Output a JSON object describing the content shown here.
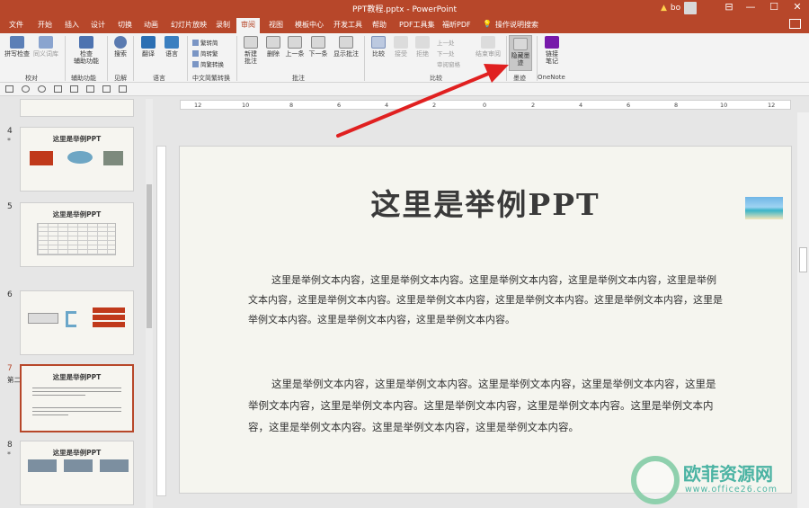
{
  "titlebar": {
    "title": "PPT教程.pptx  -  PowerPoint",
    "user": "bo",
    "warn": "▲",
    "minimize": "—",
    "maximize": "☐",
    "close": "✕",
    "ribbon_toggle": "⊟"
  },
  "tabs": [
    "文件",
    "开始",
    "插入",
    "设计",
    "切换",
    "动画",
    "幻灯片放映",
    "录制",
    "审阅",
    "视图",
    "模板中心",
    "开发工具",
    "帮助",
    "PDF工具集",
    "福昕PDF"
  ],
  "search_label": "操作说明搜索",
  "ribbon": {
    "proof": {
      "spell": "拼写检查",
      "thesaurus": "同义词库",
      "group": "校对"
    },
    "access": {
      "check": "检查",
      "check2": "辅助功能",
      "group": "辅助功能"
    },
    "insights": {
      "search": "搜索",
      "group": "见解"
    },
    "language": {
      "translate": "翻译",
      "lang": "语言",
      "group": "语言"
    },
    "chinese": {
      "t2s": "繁转简",
      "s2t": "简转繁",
      "convert": "简繁转换",
      "group": "中文简繁转换"
    },
    "comments": {
      "new1": "新建",
      "new2": "批注",
      "delete": "删除",
      "prev": "上一条",
      "next": "下一条",
      "show": "显示批注",
      "group": "批注"
    },
    "compare": {
      "compare": "比较",
      "accept": "接受",
      "reject": "拒绝",
      "prev": "上一处",
      "next": "下一处",
      "pane": "审阅窗格",
      "end": "结束审阅",
      "group": "比较"
    },
    "ink": {
      "hide1": "隐藏墨",
      "hide2": "迹",
      "group": "墨迹"
    },
    "onenote": {
      "link1": "链接",
      "link2": "笔记",
      "group": "OneNote"
    }
  },
  "ruler_ticks": [
    "12",
    "10",
    "8",
    "6",
    "4",
    "2",
    "0",
    "2",
    "4",
    "6",
    "8",
    "10",
    "12"
  ],
  "slides_panel": {
    "section": "第二章",
    "slides": [
      {
        "num": "4",
        "star": "*",
        "title": "这里是举例PPT"
      },
      {
        "num": "5",
        "star": "",
        "title": "这里是举例PPT"
      },
      {
        "num": "6",
        "star": "",
        "title": ""
      },
      {
        "num": "7",
        "star": "",
        "title": "这里是举例PPT"
      },
      {
        "num": "8",
        "star": "*",
        "title": "这里是举例PPT"
      }
    ]
  },
  "slide": {
    "title": "这里是举例PPT",
    "para1": "这里是举例文本内容，这里是举例文本内容。这里是举例文本内容，这里是举例文本内容，这里是举例文本内容，这里是举例文本内容。这里是举例文本内容，这里是举例文本内容。这里是举例文本内容，这里是举例文本内容。这里是举例文本内容，这里是举例文本内容。",
    "para2": "这里是举例文本内容，这里是举例文本内容。这里是举例文本内容，这里是举例文本内容，这里是举例文本内容，这里是举例文本内容。这里是举例文本内容，这里是举例文本内容。这里是举例文本内容，这里是举例文本内容。这里是举例文本内容，这里是举例文本内容。"
  },
  "watermark": {
    "brand": "欧菲资源网",
    "url": "www.office26.com"
  },
  "colors": {
    "accent": "#b7472a",
    "watermark": "#4bb3a3",
    "arrow": "#e02020"
  }
}
